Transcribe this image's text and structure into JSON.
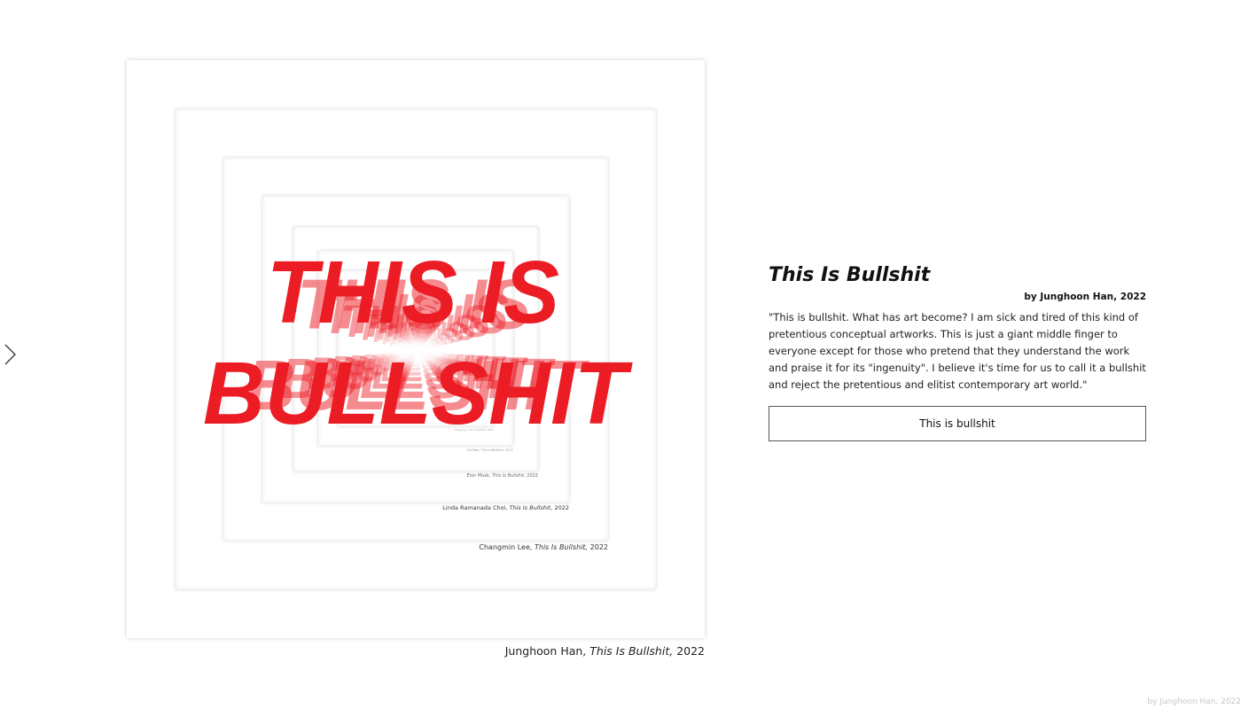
{
  "artwork": {
    "headline_line1": "THIS IS",
    "headline_line2": "BULLSHIT",
    "headline_color": "#ec1c24",
    "caption": {
      "artist": "Junghoon Han,",
      "title": "This Is Bullshit,",
      "year": "2022"
    },
    "nested_captions": [
      {
        "artist": "Changmin Lee,",
        "title": "This Is Bullshit,",
        "year": "2022"
      },
      {
        "artist": "Linda Ramanada Choi,",
        "title": "This Is Bullshit,",
        "year": "2022"
      },
      {
        "artist": "Elon Musk,",
        "title": "This Is Bullshit,",
        "year": "2022"
      },
      {
        "artist": "Jiai Nao,",
        "title": "This is Bullshit,",
        "year": "2022"
      },
      {
        "artist": "Fengpang,",
        "title": "This is Bullshit,",
        "year": "2022"
      }
    ]
  },
  "info": {
    "title": "This Is Bullshit",
    "byline": "by Junghoon Han, 2022",
    "description": "\"This is bullshit. What has art become? I am sick and tired of this kind of pretentious conceptual artworks. This is just a giant middle finger to everyone except for those who pretend that they understand the work and praise it for its \"ingenuity\". I believe it's time for us to call it a bullshit and reject the pretentious and elitist contemporary art world.\"",
    "button_label": "This is bullshit"
  },
  "nav": {
    "next_icon": "chevron-right-icon"
  },
  "footer": {
    "credit": "by Junghoon Han, 2022"
  }
}
